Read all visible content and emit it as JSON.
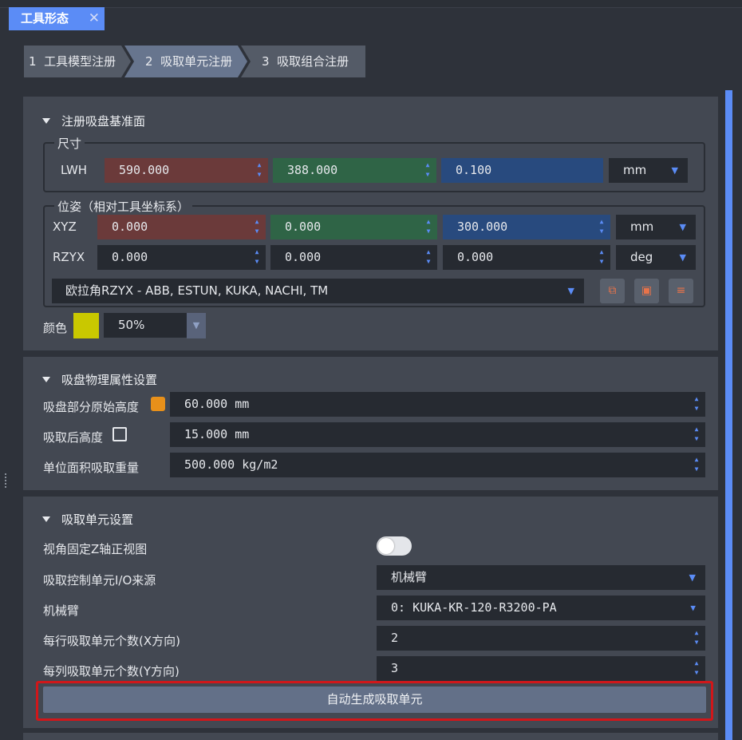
{
  "window_tab": {
    "title": "工具形态",
    "close": "✕"
  },
  "steps": [
    {
      "num": "1",
      "label": "工具模型注册"
    },
    {
      "num": "2",
      "label": "吸取单元注册"
    },
    {
      "num": "3",
      "label": "吸取组合注册"
    }
  ],
  "section1": {
    "title": "注册吸盘基准面",
    "size_group": "尺寸",
    "lwh_label": "LWH",
    "lwh_values": [
      "590.000",
      "388.000",
      "0.100"
    ],
    "lwh_unit": "mm",
    "pose_group": "位姿（相对工具坐标系）",
    "xyz_label": "XYZ",
    "xyz_values": [
      "0.000",
      "0.000",
      "300.000"
    ],
    "xyz_unit": "mm",
    "rzyx_label": "RZYX",
    "rzyx_values": [
      "0.000",
      "0.000",
      "0.000"
    ],
    "rzyx_unit": "deg",
    "euler_select": "欧拉角RZYX - ABB, ESTUN, KUKA, NACHI, TM",
    "color_label": "颜色",
    "color_swatch": "#c9c800",
    "opacity": "50%"
  },
  "section2": {
    "title": "吸盘物理属性设置",
    "rows": [
      {
        "label": "吸盘部分原始高度",
        "value": "60.000 mm"
      },
      {
        "label": "吸取后高度",
        "value": "15.000 mm"
      },
      {
        "label": "单位面积吸取重量",
        "value": "500.000 kg/m2"
      }
    ],
    "orig_height_checkbox_color": "#e8901a"
  },
  "section3": {
    "title": "吸取单元设置",
    "fixed_view_label": "视角固定Z轴正视图",
    "io_source_label": "吸取控制单元I/O来源",
    "io_source_value": "机械臂",
    "arm_label": "机械臂",
    "arm_value": "0: KUKA-KR-120-R3200-PA",
    "per_row_label": "每行吸取单元个数(X方向)",
    "per_row_value": "2",
    "per_col_label": "每列吸取单元个数(Y方向)",
    "per_col_value": "3",
    "generate_button": "自动生成吸取单元"
  },
  "colors": {
    "accent": "#5b8cf6",
    "highlight_border": "#d0171a"
  }
}
